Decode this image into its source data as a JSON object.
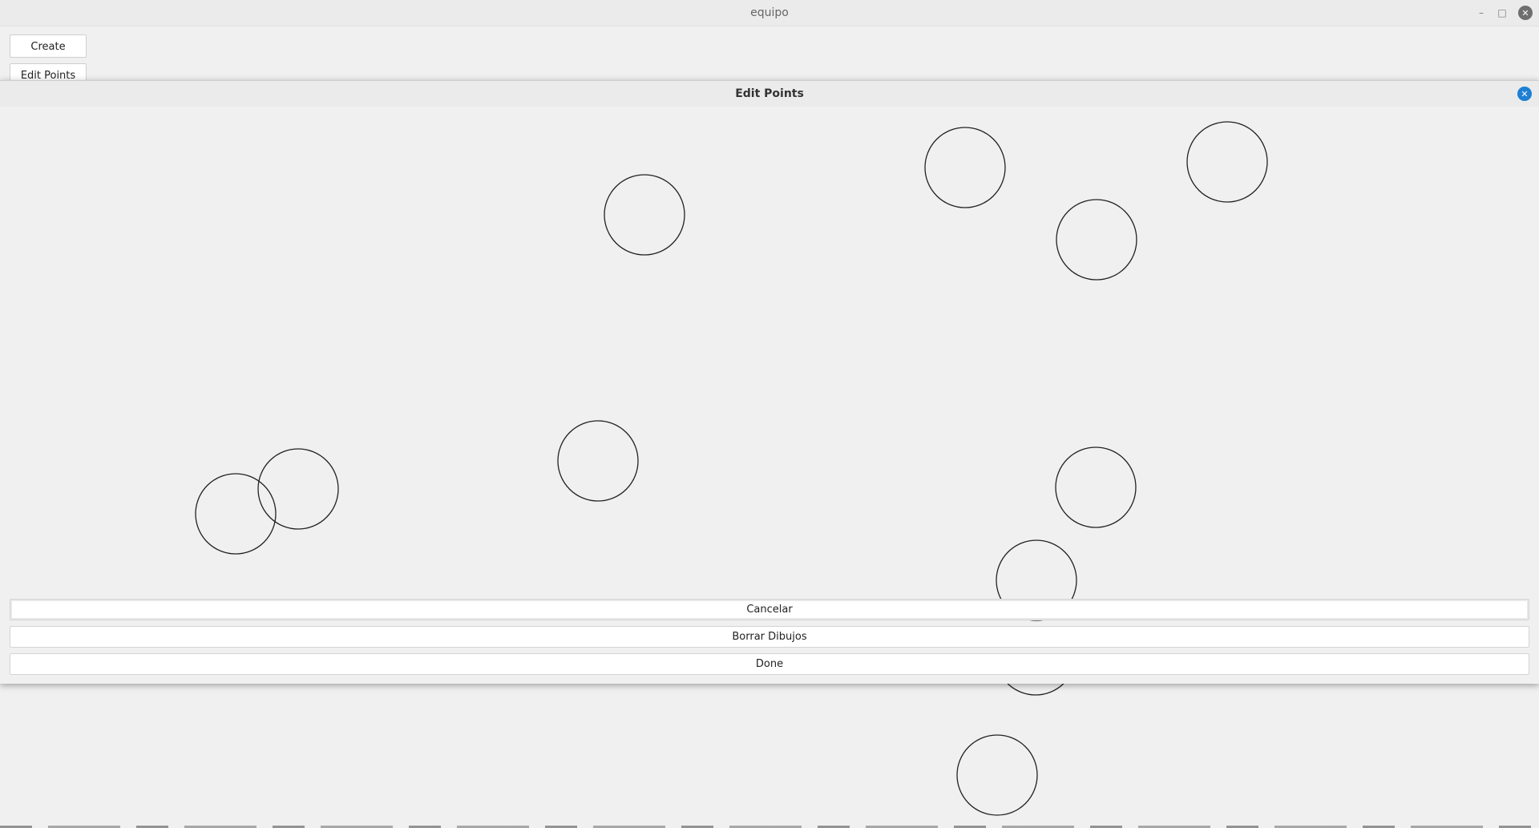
{
  "window": {
    "title": "equipo"
  },
  "toolbar": {
    "create_label": "Create",
    "edit_points_label": "Edit Points"
  },
  "dialog": {
    "title": "Edit Points",
    "cancel_label": "Cancelar",
    "clear_label": "Borrar Dibujos",
    "done_label": "Done"
  },
  "colors": {
    "accent": "#1e7fd3",
    "stroke": "#222222",
    "background": "#f0f0f0"
  }
}
